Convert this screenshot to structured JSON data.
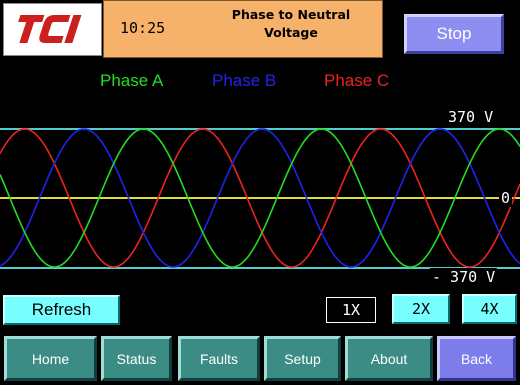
{
  "header": {
    "logo_text": "TCI",
    "time": "10:25",
    "title_line1": "Phase to Neutral",
    "title_line2": "Voltage",
    "stop_label": "Stop"
  },
  "waveform": {
    "legend": [
      {
        "label": "Phase A",
        "color": "#22dd22"
      },
      {
        "label": "Phase B",
        "color": "#2222ee"
      },
      {
        "label": "Phase C",
        "color": "#ee2222"
      }
    ],
    "max_label": "370  V",
    "zero_label": "0",
    "min_label": "- 370  V",
    "reference_line_color": "#55cccc",
    "zero_line_color": "#dddd33"
  },
  "controls": {
    "refresh_label": "Refresh",
    "zoom_1x": "1X",
    "zoom_2x": "2X",
    "zoom_4x": "4X"
  },
  "nav": {
    "home": "Home",
    "status": "Status",
    "faults": "Faults",
    "setup": "Setup",
    "about": "About",
    "back": "Back"
  },
  "colors": {
    "header_bg": "#f6b26b",
    "accent_cyan": "#77ffff",
    "nav_teal": "#3c8c86",
    "nav_back": "#7c7cea",
    "stop_bg": "#8e8ef2",
    "logo_red": "#cc1f1f"
  }
}
